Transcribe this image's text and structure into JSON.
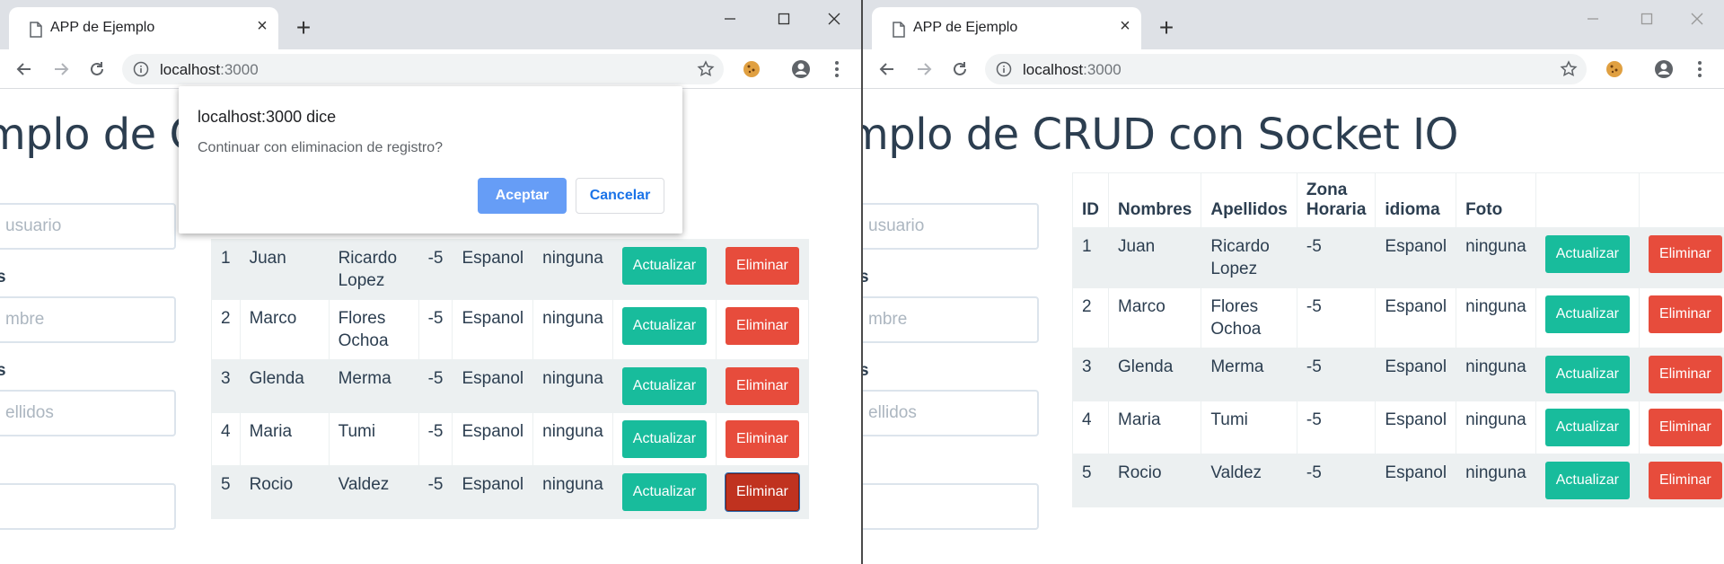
{
  "browser": {
    "tab_title": "APP de Ejemplo",
    "url_host": "localhost",
    "url_port": ":3000",
    "new_tab": "+",
    "close_tab": "×"
  },
  "page": {
    "heading_left": "mplo de CF",
    "heading_right": "mplo de CRUD con Socket IO",
    "form": {
      "usuario_placeholder": "usuario",
      "nombres_label": "s",
      "nombre_placeholder": "mbre",
      "apellidos_label": "s",
      "apellidos_placeholder": "ellidos",
      "foto_value": ""
    },
    "table": {
      "headers": [
        "ID",
        "Nombres",
        "Apellidos",
        "Zona Horaria",
        "idioma",
        "Foto"
      ],
      "update_label": "Actualizar",
      "delete_label": "Eliminar",
      "rows": [
        {
          "id": "1",
          "nombres": "Juan",
          "apellidos": "Ricardo Lopez",
          "zona": "-5",
          "idioma": "Espanol",
          "foto": "ninguna"
        },
        {
          "id": "2",
          "nombres": "Marco",
          "apellidos": "Flores Ochoa",
          "zona": "-5",
          "idioma": "Espanol",
          "foto": "ninguna"
        },
        {
          "id": "3",
          "nombres": "Glenda",
          "apellidos": "Merma",
          "zona": "-5",
          "idioma": "Espanol",
          "foto": "ninguna"
        },
        {
          "id": "4",
          "nombres": "Maria",
          "apellidos": "Tumi",
          "zona": "-5",
          "idioma": "Espanol",
          "foto": "ninguna"
        },
        {
          "id": "5",
          "nombres": "Rocio",
          "apellidos": "Valdez",
          "zona": "-5",
          "idioma": "Espanol",
          "foto": "ninguna"
        }
      ]
    }
  },
  "dialog": {
    "title": "localhost:3000 dice",
    "message": "Continuar con eliminacion de registro?",
    "ok_label": "Aceptar",
    "cancel_label": "Cancelar"
  },
  "colors": {
    "primary_text": "#2c3e50",
    "success": "#18bc9c",
    "danger": "#e74c3c",
    "dialog_ok": "#669df6"
  }
}
